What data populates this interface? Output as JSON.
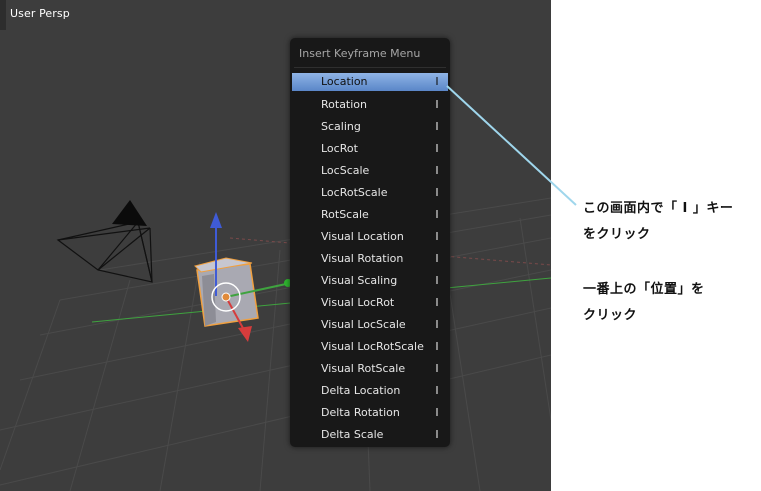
{
  "viewport": {
    "label": "User Persp"
  },
  "menu": {
    "title": "Insert Keyframe Menu",
    "items": [
      {
        "label": "Location",
        "shortcut": "I",
        "active": true
      },
      {
        "label": "Rotation",
        "shortcut": "I"
      },
      {
        "label": "Scaling",
        "shortcut": "I"
      },
      {
        "label": "LocRot",
        "shortcut": "I"
      },
      {
        "label": "LocScale",
        "shortcut": "I"
      },
      {
        "label": "LocRotScale",
        "shortcut": "I"
      },
      {
        "label": "RotScale",
        "shortcut": "I"
      },
      {
        "label": "Visual Location",
        "shortcut": "I"
      },
      {
        "label": "Visual Rotation",
        "shortcut": "I"
      },
      {
        "label": "Visual Scaling",
        "shortcut": "I"
      },
      {
        "label": "Visual LocRot",
        "shortcut": "I"
      },
      {
        "label": "Visual LocScale",
        "shortcut": "I"
      },
      {
        "label": "Visual LocRotScale",
        "shortcut": "I"
      },
      {
        "label": "Visual RotScale",
        "shortcut": "I"
      },
      {
        "label": "Delta Location",
        "shortcut": "I"
      },
      {
        "label": "Delta Rotation",
        "shortcut": "I"
      },
      {
        "label": "Delta Scale",
        "shortcut": "I"
      }
    ]
  },
  "annotations": {
    "line1": "この画面内で「 I 」キー",
    "line2": "をクリック",
    "line3": "一番上の「位置」を",
    "line4": "クリック"
  },
  "colors": {
    "highlight": "#5a86c8",
    "callout": "#9fd6ec"
  }
}
